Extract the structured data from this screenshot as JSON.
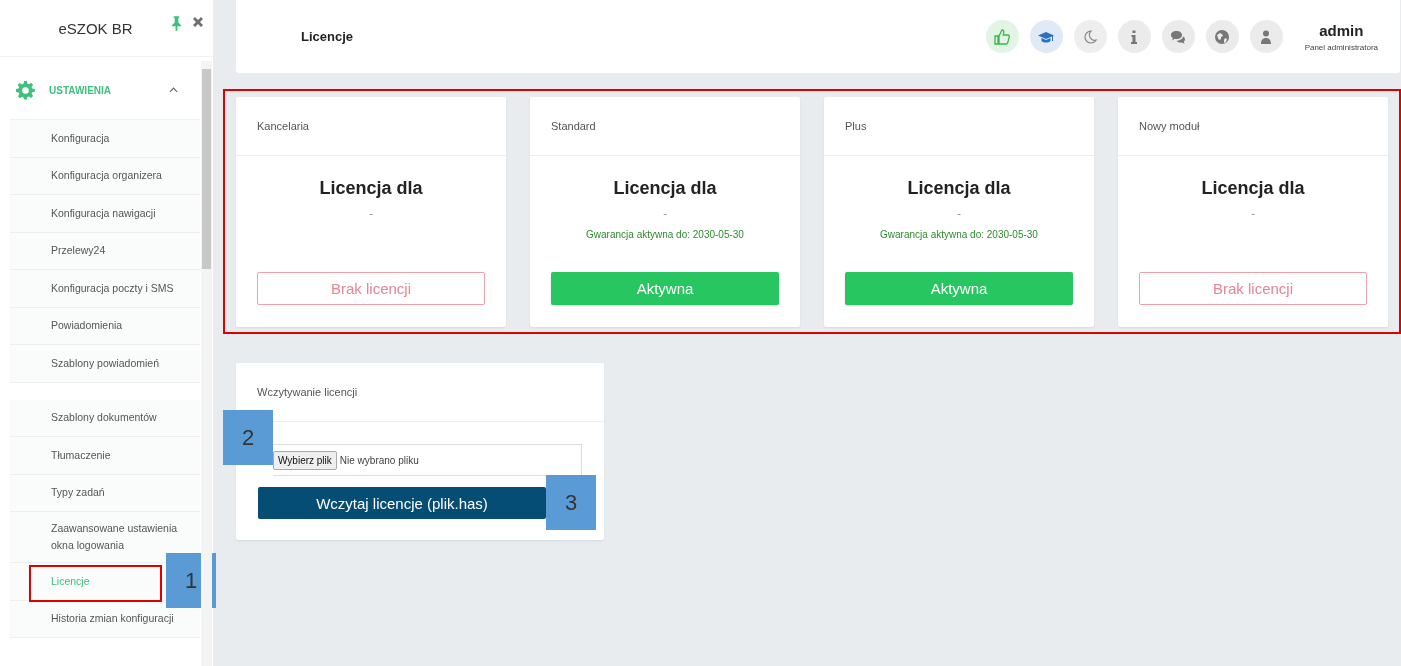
{
  "sidebar": {
    "brand": "eSZOK BR",
    "section": {
      "label": "USTAWIENIA",
      "expanded": true
    },
    "groups": [
      [
        {
          "label": "Konfiguracja",
          "selected": false
        },
        {
          "label": "Konfiguracja organizera",
          "selected": false
        },
        {
          "label": "Konfiguracja nawigacji",
          "selected": false
        },
        {
          "label": "Przelewy24",
          "selected": false
        },
        {
          "label": "Konfiguracja poczty i SMS",
          "selected": false
        },
        {
          "label": "Powiadomienia",
          "selected": false
        },
        {
          "label": "Szablony powiadomień",
          "selected": false
        }
      ],
      [
        {
          "label": "Szablony dokumentów",
          "selected": false
        },
        {
          "label": "Tłumaczenie",
          "selected": false
        },
        {
          "label": "Typy zadań",
          "selected": false
        },
        {
          "label": "Zaawansowane ustawienia okna logowania",
          "selected": false
        },
        {
          "label": "Licencje",
          "selected": true,
          "highlighted": true,
          "callout": "1"
        },
        {
          "label": "Historia zmian konfiguracji",
          "selected": false
        }
      ]
    ]
  },
  "header": {
    "title": "Licencje",
    "buttons": [
      {
        "kind": "like",
        "color": "#3cb54a"
      },
      {
        "kind": "course",
        "color": "#2b73c2"
      },
      {
        "kind": "theme",
        "color": "#8a8a8a"
      },
      {
        "kind": "info",
        "color": "#777777"
      },
      {
        "kind": "chat",
        "color": "#777777"
      },
      {
        "kind": "language",
        "color": "#777777"
      },
      {
        "kind": "user",
        "color": "#777777"
      }
    ],
    "user": {
      "name": "admin",
      "role": "Panel administratora"
    }
  },
  "licenses": {
    "highlighted": true,
    "cards": [
      {
        "title": "Kancelaria",
        "heading": "Licencja dla",
        "holder": "-",
        "status": {
          "kind": "none",
          "label": "Brak licencji"
        }
      },
      {
        "title": "Standard",
        "heading": "Licencja dla",
        "holder": "-",
        "warranty": "Gwarancja aktywna do: 2030-05-30",
        "status": {
          "kind": "active",
          "label": "Aktywna"
        }
      },
      {
        "title": "Plus",
        "heading": "Licencja dla",
        "holder": "-",
        "warranty": "Gwarancja aktywna do: 2030-05-30",
        "status": {
          "kind": "active",
          "label": "Aktywna"
        }
      },
      {
        "title": "Nowy moduł",
        "heading": "Licencja dla",
        "holder": "-",
        "status": {
          "kind": "none",
          "label": "Brak licencji"
        }
      }
    ]
  },
  "upload": {
    "title": "Wczytywanie licencji",
    "file_button": "Wybierz plik",
    "file_status": "Nie wybrano pliku",
    "file_callout": "2",
    "submit": "Wczytaj licencje (plik.has)",
    "submit_callout": "3"
  }
}
